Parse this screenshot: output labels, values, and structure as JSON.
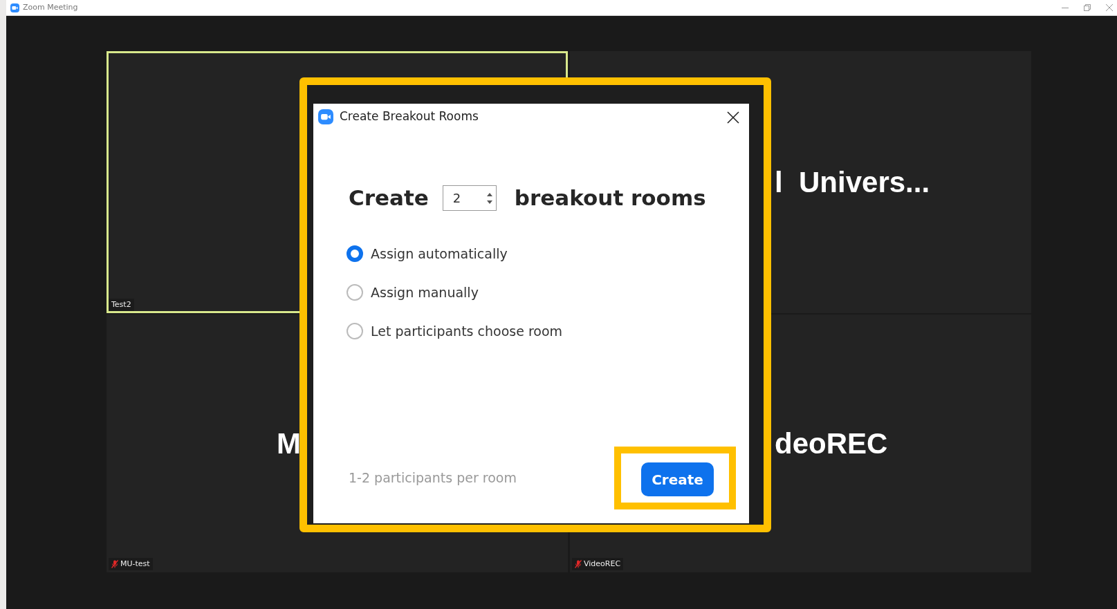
{
  "window": {
    "title": "Zoom Meeting"
  },
  "tiles": [
    {
      "label": "Test2",
      "muted": false,
      "speaking": true
    },
    {
      "display_name": "l  Univers...",
      "speaking": false
    },
    {
      "display_name": "M",
      "label": "MU-test",
      "muted": true,
      "speaking": false
    },
    {
      "display_name": "deoREC",
      "label": "VideoREC",
      "muted": true,
      "speaking": false
    }
  ],
  "dialog": {
    "title": "Create Breakout Rooms",
    "highlighted": true,
    "prefix": "Create",
    "room_count": "2",
    "suffix": "breakout rooms",
    "options": [
      {
        "label": "Assign automatically",
        "selected": true
      },
      {
        "label": "Assign manually",
        "selected": false
      },
      {
        "label": "Let participants choose room",
        "selected": false
      }
    ],
    "hint": "1-2 participants per room",
    "create_button": {
      "label": "Create",
      "highlighted": true
    }
  }
}
